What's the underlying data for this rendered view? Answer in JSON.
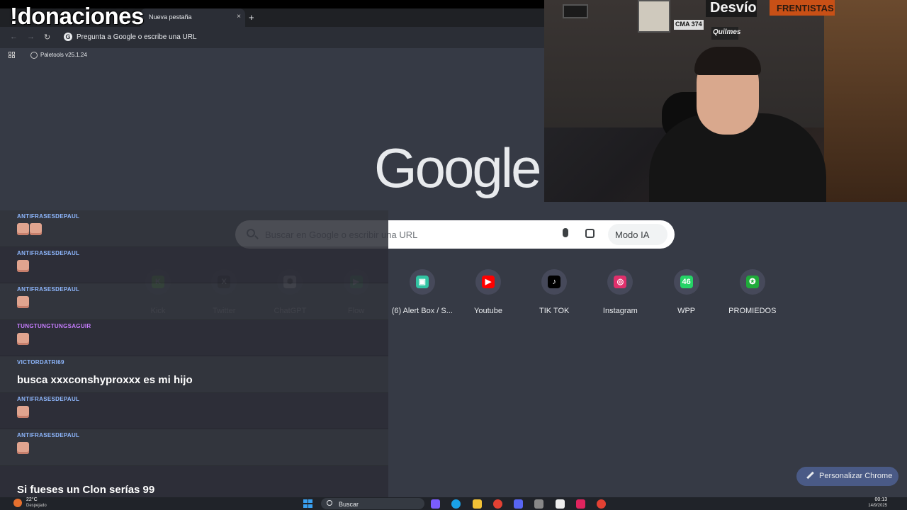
{
  "overlay": {
    "donaciones": "!donaciones"
  },
  "browser": {
    "tab_title": "Nueva pestaña",
    "tab_close": "×",
    "new_tab": "+",
    "omnibox_placeholder": "Pregunta a Google o escribe una URL",
    "bookmark_label": "Paletools v25.1.24"
  },
  "google": {
    "logo": "Google",
    "search_placeholder": "Buscar en Google o escribir una URL",
    "modo_ia": "Modo IA"
  },
  "shortcuts": [
    {
      "label": "Kick",
      "icon": "kick-icon",
      "color": "#53fc18",
      "glyph": "K"
    },
    {
      "label": "Twitter",
      "icon": "x-icon",
      "color": "#000000",
      "glyph": "X"
    },
    {
      "label": "ChatGPT",
      "icon": "chatgpt-icon",
      "color": "#ffffff",
      "glyph": "✺"
    },
    {
      "label": "Flow",
      "icon": "flow-icon",
      "color": "#1db954",
      "glyph": "▶"
    },
    {
      "label": "(6) Alert Box / S...",
      "icon": "streamlabs-icon",
      "color": "#31c3a2",
      "glyph": "▣"
    },
    {
      "label": "Youtube",
      "icon": "youtube-icon",
      "color": "#ff0000",
      "glyph": "▶"
    },
    {
      "label": "TIK TOK",
      "icon": "tiktok-icon",
      "color": "#000000",
      "glyph": "♪"
    },
    {
      "label": "Instagram",
      "icon": "instagram-icon",
      "color": "#e1306c",
      "glyph": "◎"
    },
    {
      "label": "WPP",
      "icon": "whatsapp-icon",
      "color": "#25d366",
      "glyph": "46"
    },
    {
      "label": "PROMIEDOS",
      "icon": "promiedos-icon",
      "color": "#1faa3a",
      "glyph": "✪"
    }
  ],
  "chat": [
    {
      "user": "ANTIFRASESDEPAUL",
      "color": "#8fb8ff",
      "emotes": 2,
      "text": ""
    },
    {
      "user": "ANTIFRASESDEPAUL",
      "color": "#8fb8ff",
      "emotes": 1,
      "text": ""
    },
    {
      "user": "ANTIFRASESDEPAUL",
      "color": "#8fb8ff",
      "emotes": 1,
      "text": ""
    },
    {
      "user": "TUNGTUNGTUNGSAGUIR",
      "color": "#c77dff",
      "emotes": 1,
      "text": ""
    },
    {
      "user": "VICTORDATRI69",
      "color": "#8fb8ff",
      "emotes": 0,
      "text": "busca xxxconshyproxxx es mi hijo"
    },
    {
      "user": "ANTIFRASESDEPAUL",
      "color": "#8fb8ff",
      "emotes": 1,
      "text": ""
    },
    {
      "user": "ANTIFRASESDEPAUL",
      "color": "#8fb8ff",
      "emotes": 1,
      "text": ""
    },
    {
      "user": "",
      "color": "#ff3b3b",
      "emotes": 0,
      "text": "Si fueses un Clon serías 99"
    }
  ],
  "webcam": {
    "sign_desvio": "Desvío",
    "sign_frentistas": "FRENTISTAS",
    "sign_plate": "CMA 374",
    "sign_quilmes": "Quilmes"
  },
  "personalize": "Personalizar Chrome",
  "taskbar": {
    "temperature": "22°C",
    "condition": "Despejado",
    "search": "Buscar",
    "time": "00:13",
    "date": "14/9/2025"
  }
}
